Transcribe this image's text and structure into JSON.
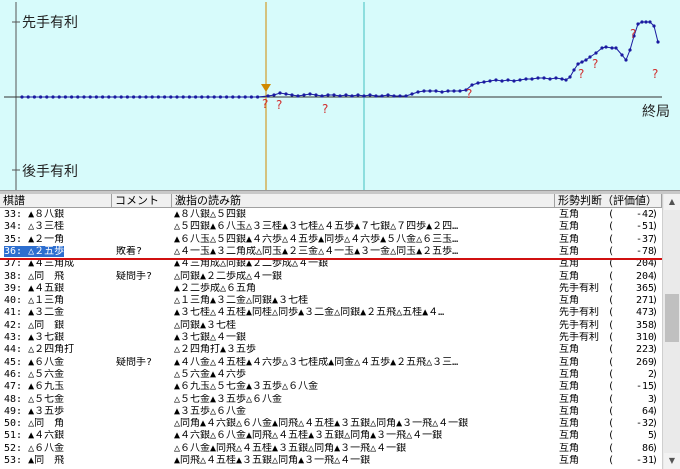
{
  "graph": {
    "top_label": "先手有利",
    "bottom_label": "後手有利",
    "end_label": "終局",
    "question_mark": "?",
    "colors": {
      "background": "#d7fbfb",
      "line": "#1a1aa0",
      "cursor": "#d08a00",
      "mark": "#d03030",
      "marker_line": "#40c0c0"
    }
  },
  "list": {
    "headers": {
      "move": "棋譜",
      "comment": "コメント",
      "pv": "激指の読み筋",
      "eval": "形勢判断（評価値）"
    },
    "rows": [
      {
        "move": "33: ▲８八銀",
        "comment": "",
        "pv": "▲８八銀△５四銀",
        "eval": "互角",
        "value": "-42",
        "selected": false
      },
      {
        "move": "34: △３三桂",
        "comment": "",
        "pv": "△５四銀▲６八玉△３三桂▲３七桂△４五歩▲７七銀△７四歩▲２四…",
        "eval": "互角",
        "value": "-51",
        "selected": false
      },
      {
        "move": "35: ▲２一角",
        "comment": "",
        "pv": "▲６八玉△５四銀▲４六歩△４五歩▲同歩△４六歩▲５八金△６三玉…",
        "eval": "互角",
        "value": "-37",
        "selected": false
      },
      {
        "move": "36: △２五歩",
        "comment": "敗着?",
        "pv": "△４一玉▲３二角成△同玉▲２三金△４一玉▲３一金△同玉▲２五歩…",
        "eval": "互角",
        "value": "-78",
        "selected": true
      },
      {
        "move": "37: ▲４三角成",
        "comment": "",
        "pv": "▲４三角成△同銀▲２二歩成△４一銀",
        "eval": "互角",
        "value": "204",
        "selected": false
      },
      {
        "move": "38: △同　飛",
        "comment": "疑問手?",
        "pv": "△同銀▲２二歩成△４一銀",
        "eval": "互角",
        "value": "204",
        "selected": false
      },
      {
        "move": "39: ▲４五銀",
        "comment": "",
        "pv": "▲２二歩成△６五角",
        "eval": "先手有利",
        "value": "365",
        "selected": false
      },
      {
        "move": "40: △１三角",
        "comment": "",
        "pv": "△１三角▲３二金△同銀▲３七桂",
        "eval": "互角",
        "value": "271",
        "selected": false
      },
      {
        "move": "41: ▲３二金",
        "comment": "",
        "pv": "▲３七桂△４五桂▲同桂△同歩▲３二金△同銀▲２五飛△五桂▲４…",
        "eval": "先手有利",
        "value": "473",
        "selected": false
      },
      {
        "move": "42: △同　銀",
        "comment": "",
        "pv": "△同銀▲３七桂",
        "eval": "先手有利",
        "value": "358",
        "selected": false
      },
      {
        "move": "43: ▲３七銀",
        "comment": "",
        "pv": "▲３七銀△４一銀",
        "eval": "先手有利",
        "value": "310",
        "selected": false
      },
      {
        "move": "44: △２四角打",
        "comment": "",
        "pv": "△２四角打▲３五歩",
        "eval": "互角",
        "value": "223",
        "selected": false
      },
      {
        "move": "45: ▲６八金",
        "comment": "疑問手?",
        "pv": "▲４八金△４五桂▲４六歩△３七桂成▲同金△４五歩▲２五飛△３三…",
        "eval": "互角",
        "value": "269",
        "selected": false
      },
      {
        "move": "46: △５六金",
        "comment": "",
        "pv": "△５六金▲４六歩",
        "eval": "互角",
        "value": "2",
        "selected": false
      },
      {
        "move": "47: ▲６九玉",
        "comment": "",
        "pv": "▲６九玉△５七金▲３五歩△６八金",
        "eval": "互角",
        "value": "-15",
        "selected": false
      },
      {
        "move": "48: △５七金",
        "comment": "",
        "pv": "△５七金▲３五歩△６八金",
        "eval": "互角",
        "value": "3",
        "selected": false
      },
      {
        "move": "49: ▲３五歩",
        "comment": "",
        "pv": "▲３五歩△６八金",
        "eval": "互角",
        "value": "64",
        "selected": false
      },
      {
        "move": "50: △同　角",
        "comment": "",
        "pv": "△同角▲４六銀△６八金▲同飛△４五桂▲３五銀△同角▲３一飛△４一銀",
        "eval": "互角",
        "value": "-32",
        "selected": false
      },
      {
        "move": "51: ▲４六銀",
        "comment": "",
        "pv": "▲４六銀△６八金▲同飛△４五桂▲３五銀△同角▲３一飛△４一銀",
        "eval": "互角",
        "value": "5",
        "selected": false
      },
      {
        "move": "52: △６八金",
        "comment": "",
        "pv": "△６八金▲同飛△４五桂▲３五銀△同角▲３一飛△４一銀",
        "eval": "互角",
        "value": "86",
        "selected": false
      },
      {
        "move": "53: ▲同　飛",
        "comment": "",
        "pv": "▲同飛△４五桂▲３五銀△同角▲３一飛△４一銀",
        "eval": "互角",
        "value": "-31",
        "selected": false
      }
    ]
  }
}
